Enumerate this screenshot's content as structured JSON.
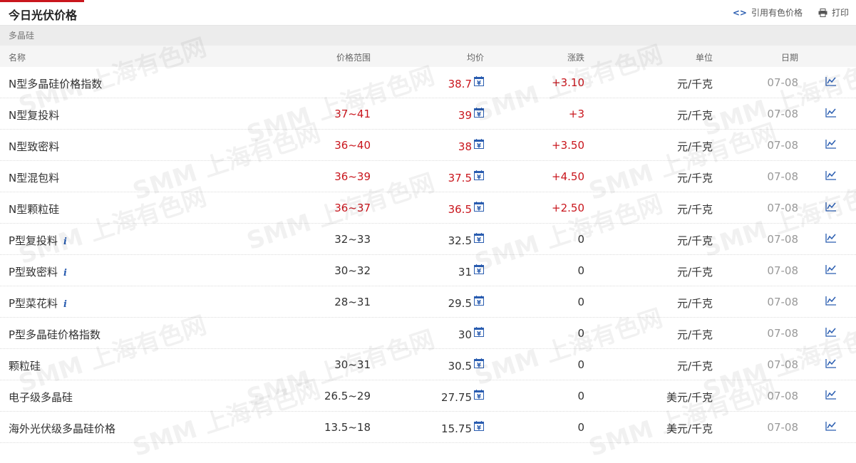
{
  "header": {
    "title": "今日光伏价格",
    "cite_label": "引用有色价格",
    "print_label": "打印",
    "accent_color": "#c9161d"
  },
  "section": {
    "title": "多晶硅"
  },
  "columns": {
    "name": "名称",
    "range": "价格范围",
    "avg": "均价",
    "change": "涨跌",
    "unit": "单位",
    "date": "日期"
  },
  "watermark": "SMM 上海有色网",
  "rows": [
    {
      "name": "N型多晶硅价格指数",
      "info": false,
      "range": "",
      "avg": "38.7",
      "change": "+3.10",
      "unit": "元/千克",
      "date": "07-08",
      "up": true
    },
    {
      "name": "N型复投料",
      "info": false,
      "range": "37~41",
      "avg": "39",
      "change": "+3",
      "unit": "元/千克",
      "date": "07-08",
      "up": true
    },
    {
      "name": "N型致密料",
      "info": false,
      "range": "36~40",
      "avg": "38",
      "change": "+3.50",
      "unit": "元/千克",
      "date": "07-08",
      "up": true
    },
    {
      "name": "N型混包料",
      "info": false,
      "range": "36~39",
      "avg": "37.5",
      "change": "+4.50",
      "unit": "元/千克",
      "date": "07-08",
      "up": true
    },
    {
      "name": "N型颗粒硅",
      "info": false,
      "range": "36~37",
      "avg": "36.5",
      "change": "+2.50",
      "unit": "元/千克",
      "date": "07-08",
      "up": true
    },
    {
      "name": "P型复投料",
      "info": true,
      "range": "32~33",
      "avg": "32.5",
      "change": "0",
      "unit": "元/千克",
      "date": "07-08",
      "up": false
    },
    {
      "name": "P型致密料",
      "info": true,
      "range": "30~32",
      "avg": "31",
      "change": "0",
      "unit": "元/千克",
      "date": "07-08",
      "up": false
    },
    {
      "name": "P型菜花料",
      "info": true,
      "range": "28~31",
      "avg": "29.5",
      "change": "0",
      "unit": "元/千克",
      "date": "07-08",
      "up": false
    },
    {
      "name": "P型多晶硅价格指数",
      "info": false,
      "range": "",
      "avg": "30",
      "change": "0",
      "unit": "元/千克",
      "date": "07-08",
      "up": false
    },
    {
      "name": "颗粒硅",
      "info": false,
      "range": "30~31",
      "avg": "30.5",
      "change": "0",
      "unit": "元/千克",
      "date": "07-08",
      "up": false
    },
    {
      "name": "电子级多晶硅",
      "info": false,
      "range": "26.5~29",
      "avg": "27.75",
      "change": "0",
      "unit": "美元/千克",
      "date": "07-08",
      "up": false
    },
    {
      "name": "海外光伏级多晶硅价格",
      "info": false,
      "range": "13.5~18",
      "avg": "15.75",
      "change": "0",
      "unit": "美元/千克",
      "date": "07-08",
      "up": false
    }
  ],
  "icons": {
    "cite": "code-icon",
    "print": "printer-icon",
    "calendar": "calendar-yen-icon",
    "chart": "line-chart-icon",
    "info": "info-icon"
  }
}
